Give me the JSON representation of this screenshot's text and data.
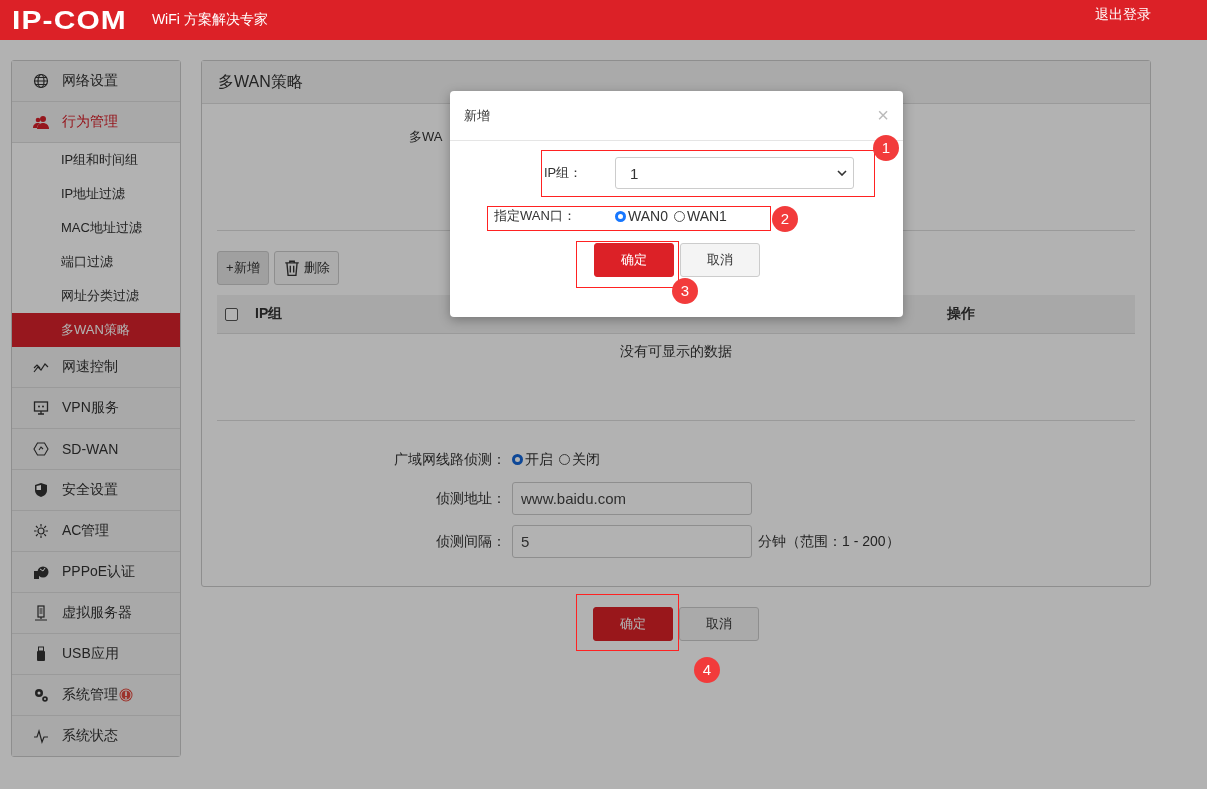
{
  "header": {
    "logo": "IP-COM",
    "tagline": "WiFi 方案解决专家",
    "logout": "退出登录"
  },
  "sidebar": {
    "items": [
      {
        "label": "网络设置",
        "kind": "globe",
        "selected": false,
        "alert": false
      },
      {
        "label": "行为管理",
        "kind": "users",
        "selected": true,
        "alert": false,
        "children": [
          {
            "label": "IP组和时间组",
            "selected": false
          },
          {
            "label": "IP地址过滤",
            "selected": false
          },
          {
            "label": "MAC地址过滤",
            "selected": false
          },
          {
            "label": "端口过滤",
            "selected": false
          },
          {
            "label": "网址分类过滤",
            "selected": false
          },
          {
            "label": "多WAN策略",
            "selected": true
          }
        ]
      },
      {
        "label": "网速控制",
        "kind": "speed",
        "selected": false,
        "alert": false
      },
      {
        "label": "VPN服务",
        "kind": "monitor",
        "selected": false,
        "alert": false
      },
      {
        "label": "SD-WAN",
        "kind": "hexagon",
        "selected": false,
        "alert": false
      },
      {
        "label": "安全设置",
        "kind": "shield",
        "selected": false,
        "alert": false
      },
      {
        "label": "AC管理",
        "kind": "tools",
        "selected": false,
        "alert": false
      },
      {
        "label": "PPPoE认证",
        "kind": "pppoe",
        "selected": false,
        "alert": false
      },
      {
        "label": "虚拟服务器",
        "kind": "server",
        "selected": false,
        "alert": false
      },
      {
        "label": "USB应用",
        "kind": "usb",
        "selected": false,
        "alert": false
      },
      {
        "label": "系统管理",
        "kind": "gears",
        "selected": false,
        "alert": true
      },
      {
        "label": "系统状态",
        "kind": "pulse",
        "selected": false,
        "alert": false
      }
    ]
  },
  "panel": {
    "title": "多WAN策略",
    "setting_label": "多WA",
    "toolbar": [
      {
        "label": "+新增",
        "kind": "add"
      },
      {
        "label": "删除",
        "kind": "delete"
      }
    ],
    "table": {
      "select_all": {
        "checked": false
      },
      "columns": [
        "IP组",
        "操作"
      ],
      "empty_text": "没有可显示的数据"
    },
    "detect": {
      "label": "广域网线路侦测：",
      "options": [
        {
          "label": "开启",
          "selected": true
        },
        {
          "label": "关闭",
          "selected": false
        }
      ]
    },
    "address": {
      "label": "侦测地址：",
      "value": "www.baidu.com"
    },
    "interval": {
      "label": "侦测间隔：",
      "value": "5",
      "suffix": "分钟（范围：1 - 200）"
    }
  },
  "actions": [
    "确定",
    "取消"
  ],
  "dialog": {
    "title": "新增",
    "close": "×",
    "ip_group": {
      "label": "IP组：",
      "value": "1"
    },
    "wan": {
      "label": "指定WAN口：",
      "options": [
        {
          "label": "WAN0",
          "selected": true
        },
        {
          "label": "WAN1",
          "selected": false
        }
      ]
    },
    "buttons": [
      "确定",
      "取消"
    ]
  },
  "annotations": [
    {
      "number": "1"
    },
    {
      "number": "2"
    },
    {
      "number": "3"
    },
    {
      "number": "4"
    }
  ]
}
